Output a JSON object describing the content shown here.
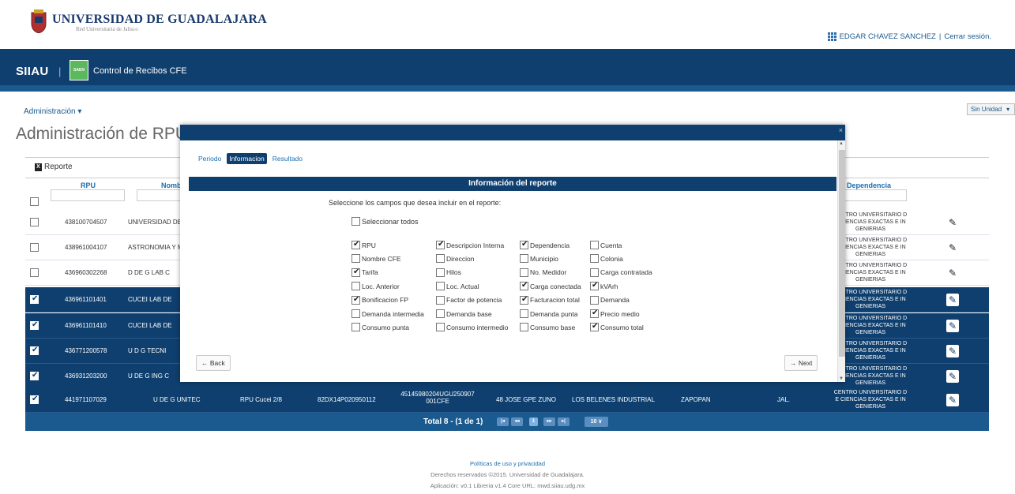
{
  "header": {
    "university": "UNIVERSIDAD DE GUADALAJARA",
    "subtitle": "Red Universitaria de Jalisco",
    "user": "EDGAR CHAVEZ SANCHEZ",
    "divider": "|",
    "logout": "Cerrar sesión."
  },
  "navbar": {
    "brand": "SIIAU",
    "separator": "|",
    "badge": "SAEN",
    "app_title": "Control de Recibos CFE"
  },
  "menu": {
    "admin": "Administración ▾",
    "unit_select": "Sin Unidad"
  },
  "page": {
    "title": "Administración de RPU",
    "report_button": "Reporte"
  },
  "table": {
    "headers": {
      "rpu": "RPU",
      "nombre": "Nombre",
      "dependencia": "Dependencia"
    },
    "rows": [
      {
        "selected": false,
        "rpu": "438100704507",
        "name": "UNIVERSIDAD DE GUADALAJARA",
        "dep": "CENTRO UNIVERSITARIO DE CIENCIAS EXACTAS E INGENIERIAS"
      },
      {
        "selected": false,
        "rpu": "438961004107",
        "name": "ASTRONOMIA Y METEOROLOGIA",
        "dep": "CENTRO UNIVERSITARIO DE CIENCIAS EXACTAS E INGENIERIAS"
      },
      {
        "selected": false,
        "rpu": "436960302268",
        "name": "D DE G LAB C",
        "dep": "CENTRO UNIVERSITARIO DE CIENCIAS EXACTAS E INGENIERIAS"
      },
      {
        "selected": true,
        "rpu": "436961101401",
        "name": "CUCEI LAB DE",
        "dep": "CENTRO UNIVERSITARIO DE CIENCIAS EXACTAS E INGENIERIAS"
      },
      {
        "selected": true,
        "rpu": "436961101410",
        "name": "CUCEI LAB DE",
        "dep": "CENTRO UNIVERSITARIO DE CIENCIAS EXACTAS E INGENIERIAS"
      },
      {
        "selected": true,
        "rpu": "436771200578",
        "name": "U D G TECNI",
        "dep": "CENTRO UNIVERSITARIO DE CIENCIAS EXACTAS E INGENIERIAS"
      },
      {
        "selected": true,
        "rpu": "436931203200",
        "name": "U DE G ING C",
        "dep": "CENTRO UNIVERSITARIO DE CIENCIAS EXACTAS E INGENIERIAS"
      },
      {
        "selected": true,
        "rpu": "441971107029",
        "name": "U DE G UNITEC",
        "desc": "RPU Cucei 2/8",
        "medidor": "82DX14P020950112",
        "cuenta": "45145980204UGU250907 001CFE",
        "dir": "48 JOSE GPE ZUNO",
        "col": "LOS BELENES INDUSTRIAL",
        "mun": "ZAPOPAN",
        "edo": "JAL.",
        "dep": "CENTRO UNIVERSITARIO DE CIENCIAS EXACTAS E INGENIERIAS"
      }
    ],
    "dep_display": [
      "CENTRO UNIVERSITARIO D",
      "E CIENCIAS EXACTAS E IN",
      "GENIERIAS"
    ],
    "total": "Total 8 - (1 de 1)",
    "pager": {
      "first": "|◂",
      "prev": "◂◂",
      "page": "1",
      "next": "▸▸",
      "last": "▸|",
      "size": "10 ∨"
    }
  },
  "modal": {
    "tabs": [
      "Periodo",
      "Informacion",
      "Resultado"
    ],
    "active_tab": "Informacion",
    "section_title": "Información del reporte",
    "instructions": "Seleccione los campos que desea incluir en el reporte:",
    "select_all": "Seleccionar todos",
    "fields": [
      [
        {
          "label": "RPU",
          "on": true
        },
        {
          "label": "Descripcion Interna",
          "on": true
        },
        {
          "label": "Dependencia",
          "on": true
        },
        {
          "label": "Cuenta",
          "on": false
        }
      ],
      [
        {
          "label": "Nombre CFE",
          "on": false
        },
        {
          "label": "Direccion",
          "on": false
        },
        {
          "label": "Municipio",
          "on": false
        },
        {
          "label": "Colonia",
          "on": false
        }
      ],
      [
        {
          "label": "Tarifa",
          "on": true
        },
        {
          "label": "Hilos",
          "on": false
        },
        {
          "label": "No. Medidor",
          "on": false
        },
        {
          "label": "Carga contratada",
          "on": false
        }
      ],
      [
        {
          "label": "Loc. Anterior",
          "on": false
        },
        {
          "label": "Loc. Actual",
          "on": false
        },
        {
          "label": "Carga conectada",
          "on": true
        },
        {
          "label": "kVArh",
          "on": true
        }
      ],
      [
        {
          "label": "Bonificacion FP",
          "on": true
        },
        {
          "label": "Factor de potencia",
          "on": false
        },
        {
          "label": "Facturacion total",
          "on": true
        },
        {
          "label": "Demanda",
          "on": false
        }
      ],
      [
        {
          "label": "Demanda intermedia",
          "on": false
        },
        {
          "label": "Demanda base",
          "on": false
        },
        {
          "label": "Demanda punta",
          "on": false
        },
        {
          "label": "Precio medio",
          "on": true
        }
      ],
      [
        {
          "label": "Consumo punta",
          "on": false
        },
        {
          "label": "Consumo intermedio",
          "on": false
        },
        {
          "label": "Consumo base",
          "on": false
        },
        {
          "label": "Consumo total",
          "on": true
        }
      ]
    ],
    "back": "← Back",
    "next": "→ Next",
    "close": "×"
  },
  "footer": {
    "policy": "Políticas de uso y privacidad",
    "rights": "Derechos reservados ©2015. Universidad de Guadalajara.",
    "app": "Aplicación: v0.1 Libreria v1.4 Core URL: mwd.siiau.udg.mx"
  },
  "colors": {
    "navy": "#0f3f6e",
    "accent": "#1a6fb0",
    "saen_green": "#5cb85c"
  }
}
